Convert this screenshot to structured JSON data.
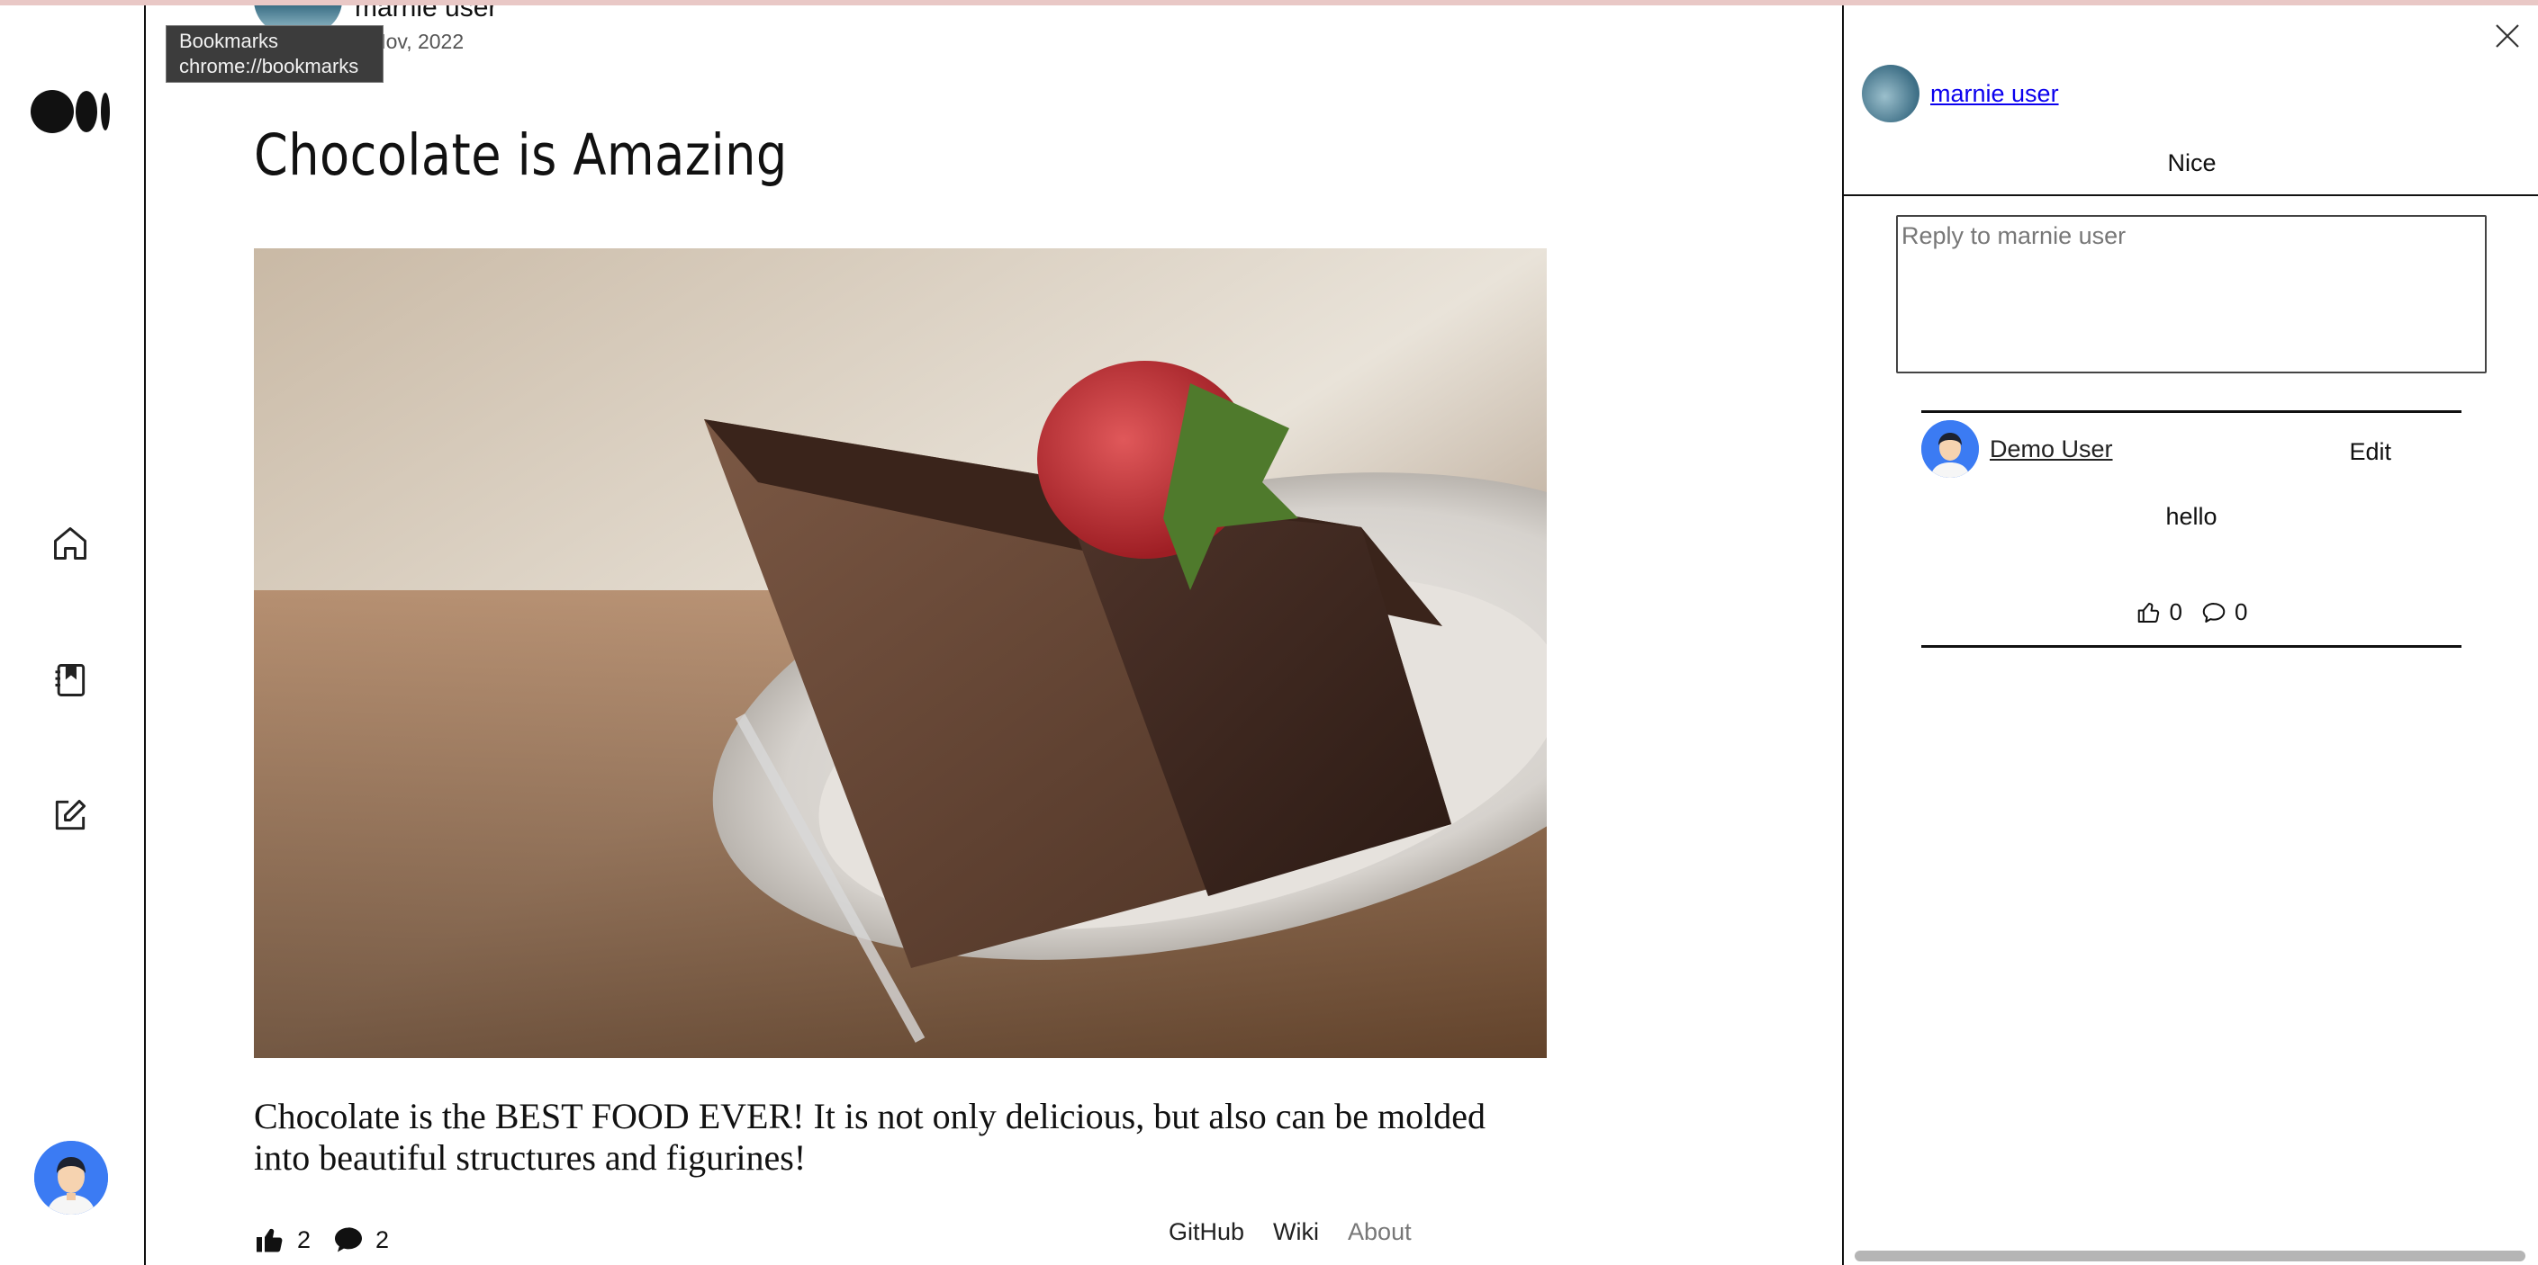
{
  "browser": {
    "tooltip_title": "Bookmarks",
    "tooltip_url": "chrome://bookmarks"
  },
  "sidebar": {
    "icons": [
      "medium-logo",
      "home-icon",
      "bookmarks-icon",
      "write-icon",
      "user-avatar"
    ]
  },
  "post": {
    "author": "marnie user",
    "date": "Nov, 2022",
    "title": "Chocolate is Amazing",
    "image_alt": "Slice of chocolate cake with a strawberry on a plate",
    "body": "Chocolate is the BEST FOOD EVER! It is not only delicious, but also can be molded into beautiful structures and figurines!",
    "likes": "2",
    "comments": "2"
  },
  "footer": {
    "links": [
      "GitHub",
      "Wiki",
      "About"
    ]
  },
  "comments_panel": {
    "comment": {
      "author": "marnie user",
      "text": "Nice"
    },
    "reply_placeholder": "Reply to marnie user",
    "reply": {
      "author": "Demo User",
      "edit_label": "Edit",
      "text": "hello",
      "likes": "0",
      "replies": "0"
    }
  },
  "colors": {
    "accent_link": "#0b00ee",
    "avatar_blue": "#3b7bf3",
    "text": "#111111"
  }
}
